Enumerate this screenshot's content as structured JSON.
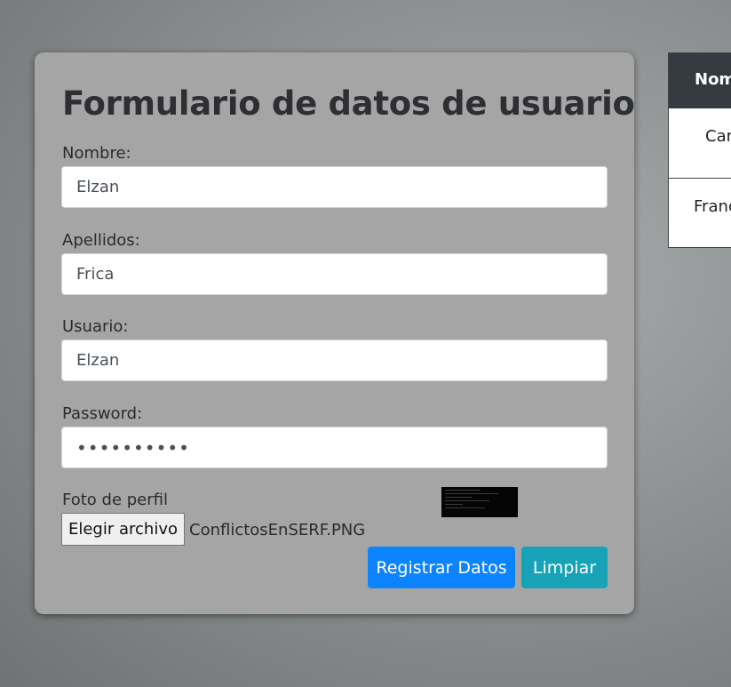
{
  "form": {
    "title": "Formulario de datos de usuario",
    "fields": {
      "nombre": {
        "label": "Nombre:",
        "value": "Elzan"
      },
      "apellidos": {
        "label": "Apellidos:",
        "value": "Frica"
      },
      "usuario": {
        "label": "Usuario:",
        "value": "Elzan"
      },
      "password": {
        "label": "Password:",
        "value": "••••••••••"
      }
    },
    "photo": {
      "label": "Foto de perfil",
      "button_label": "Elegir archivo",
      "file_name": "ConflictosEnSERF.PNG"
    },
    "buttons": {
      "register": "Registrar Datos",
      "clear": "Limpiar"
    }
  },
  "table": {
    "header": "Nom",
    "rows": [
      "Car",
      "Franc"
    ]
  },
  "colors": {
    "primary": "#0d84ff",
    "info": "#17a2b8",
    "table_header": "#343a40",
    "card": "#a5a5a5"
  }
}
